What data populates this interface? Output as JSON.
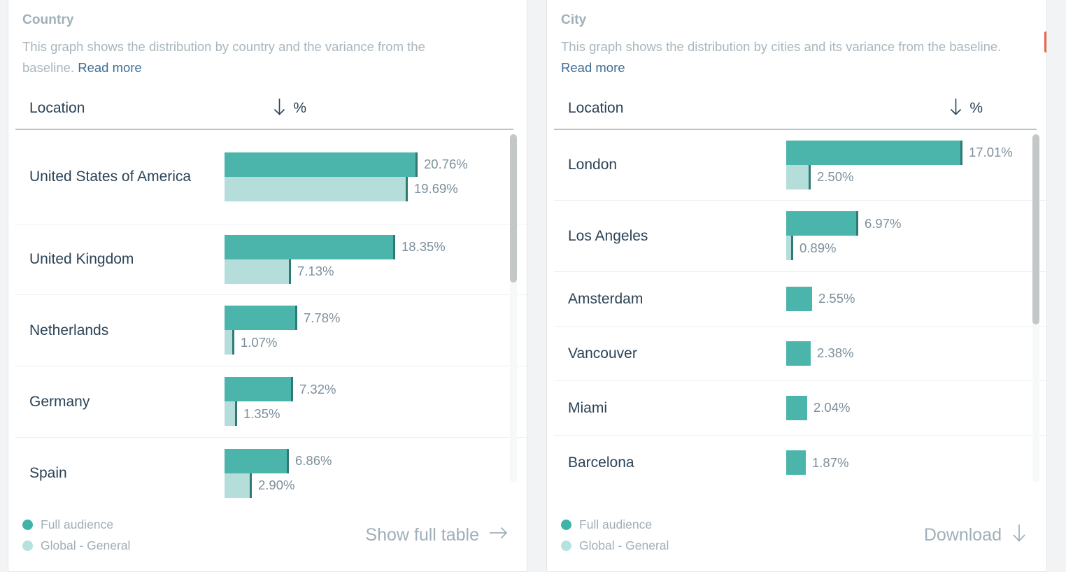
{
  "panels": [
    {
      "title": "Country",
      "description": "This graph shows the distribution by country and the variance from the baseline.",
      "read_more": "Read more",
      "col_location": "Location",
      "col_percent": "%",
      "sort_icon": "arrow-down-icon",
      "legend": {
        "full": "Full audience",
        "global": "Global - General"
      },
      "action": "Show full table",
      "action_icon": "arrow-right-icon",
      "rows": [
        {
          "label": "United States of America",
          "primary": "20.76%",
          "baseline": "19.69%",
          "primary_value": 20.76,
          "baseline_value": 19.69
        },
        {
          "label": "United Kingdom",
          "primary": "18.35%",
          "baseline": "7.13%",
          "primary_value": 18.35,
          "baseline_value": 7.13
        },
        {
          "label": "Netherlands",
          "primary": "7.78%",
          "baseline": "1.07%",
          "primary_value": 7.78,
          "baseline_value": 1.07
        },
        {
          "label": "Germany",
          "primary": "7.32%",
          "baseline": "1.35%",
          "primary_value": 7.32,
          "baseline_value": 1.35
        },
        {
          "label": "Spain",
          "primary": "6.86%",
          "baseline": "2.90%",
          "primary_value": 6.86,
          "baseline_value": 2.9
        }
      ]
    },
    {
      "title": "City",
      "description": "This graph shows the distribution by cities and its variance from the baseline.",
      "read_more": "Read more",
      "col_location": "Location",
      "col_percent": "%",
      "sort_icon": "arrow-down-icon",
      "legend": {
        "full": "Full audience",
        "global": "Global - General"
      },
      "action": "Download",
      "action_icon": "arrow-down-icon",
      "rows": [
        {
          "label": "London",
          "primary": "17.01%",
          "baseline": "2.50%",
          "primary_value": 17.01,
          "baseline_value": 2.5
        },
        {
          "label": "Los Angeles",
          "primary": "6.97%",
          "baseline": "0.89%",
          "primary_value": 6.97,
          "baseline_value": 0.89
        },
        {
          "label": "Amsterdam",
          "primary": "2.55%",
          "baseline": "",
          "primary_value": 2.55,
          "baseline_value": 0
        },
        {
          "label": "Vancouver",
          "primary": "2.38%",
          "baseline": "",
          "primary_value": 2.38,
          "baseline_value": 0
        },
        {
          "label": "Miami",
          "primary": "2.04%",
          "baseline": "",
          "primary_value": 2.04,
          "baseline_value": 0
        },
        {
          "label": "Barcelona",
          "primary": "1.87%",
          "baseline": "",
          "primary_value": 1.87,
          "baseline_value": 0
        }
      ]
    }
  ],
  "chart_data": [
    {
      "type": "bar",
      "title": "Country",
      "orientation": "horizontal",
      "xlabel": "%",
      "ylabel": "Location",
      "categories": [
        "United States of America",
        "United Kingdom",
        "Netherlands",
        "Germany",
        "Spain"
      ],
      "series": [
        {
          "name": "Full audience",
          "color": "#4cb5ab",
          "values": [
            20.76,
            18.35,
            7.78,
            7.32,
            6.86
          ]
        },
        {
          "name": "Global - General",
          "color": "#b5dedb",
          "values": [
            19.69,
            7.13,
            1.07,
            1.35,
            2.9
          ]
        }
      ],
      "xlim": [
        0,
        20.76
      ],
      "grid": false,
      "legend_position": "bottom-left",
      "sorted_by": "% descending"
    },
    {
      "type": "bar",
      "title": "City",
      "orientation": "horizontal",
      "xlabel": "%",
      "ylabel": "Location",
      "categories": [
        "London",
        "Los Angeles",
        "Amsterdam",
        "Vancouver",
        "Miami",
        "Barcelona"
      ],
      "series": [
        {
          "name": "Full audience",
          "color": "#4cb5ab",
          "values": [
            17.01,
            6.97,
            2.55,
            2.38,
            2.04,
            1.87
          ]
        },
        {
          "name": "Global - General",
          "color": "#b5dedb",
          "values": [
            2.5,
            0.89,
            0,
            0,
            0,
            0
          ]
        }
      ],
      "xlim": [
        0,
        17.01
      ],
      "grid": false,
      "legend_position": "bottom-left",
      "sorted_by": "% descending"
    }
  ],
  "colors": {
    "primary": "#4cb5ab",
    "baseline": "#b5dedb",
    "tick": "#2f7a74",
    "text": "#2b4356",
    "muted": "#a0aeb6",
    "link": "#3d6e96",
    "accent_marker": "#e8664a"
  }
}
